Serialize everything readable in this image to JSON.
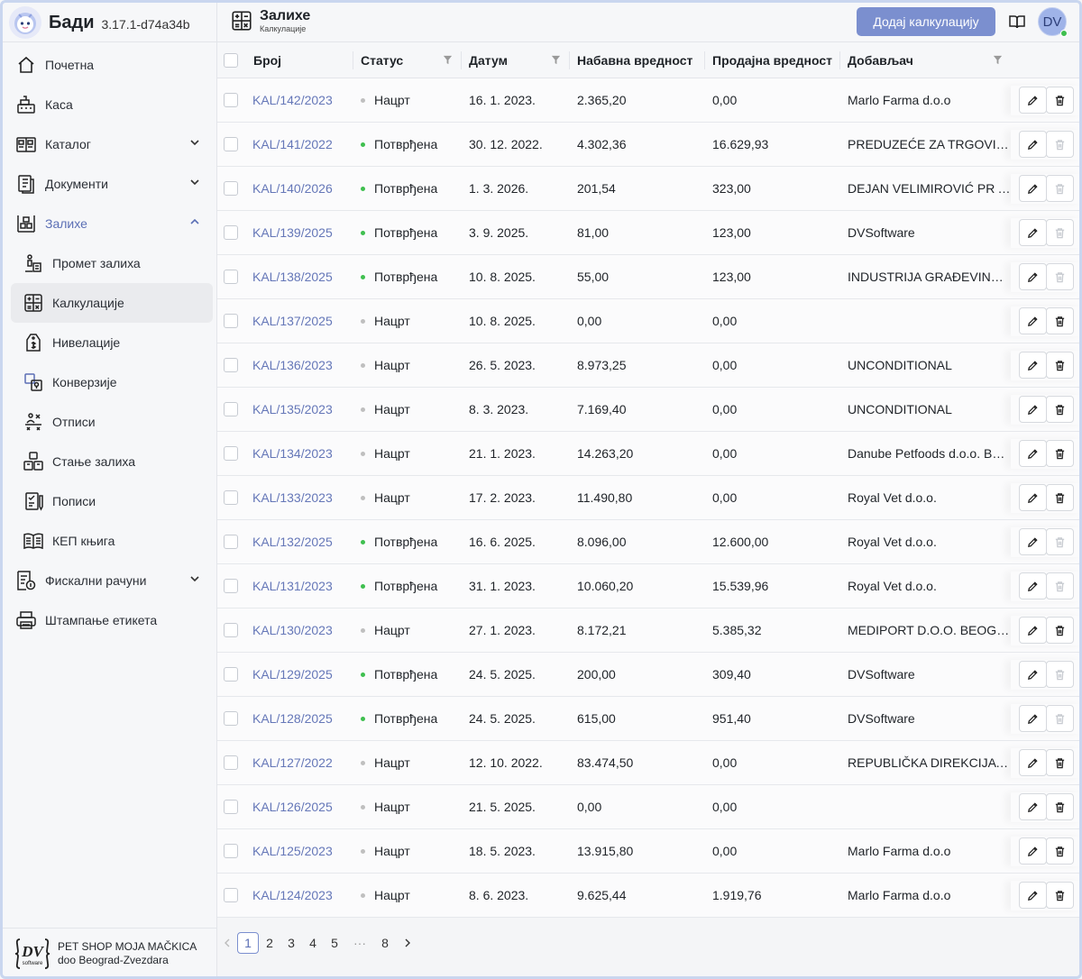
{
  "app": {
    "name": "Бади",
    "version": "3.17.1-d74a34b"
  },
  "sidebar": {
    "items": [
      {
        "label": "Почетна",
        "icon": "home-icon"
      },
      {
        "label": "Каса",
        "icon": "cash-register-icon"
      },
      {
        "label": "Каталог",
        "icon": "catalog-icon"
      },
      {
        "label": "Документи",
        "icon": "documents-icon"
      },
      {
        "label": "Залихе",
        "icon": "inventory-icon"
      },
      {
        "label": "Промет залиха",
        "icon": "stock-movement-icon"
      },
      {
        "label": "Калкулације",
        "icon": "calculator-icon"
      },
      {
        "label": "Нивелације",
        "icon": "price-tag-icon"
      },
      {
        "label": "Конверзије",
        "icon": "conversion-icon"
      },
      {
        "label": "Отписи",
        "icon": "write-off-icon"
      },
      {
        "label": "Стање залиха",
        "icon": "boxes-icon"
      },
      {
        "label": "Пописи",
        "icon": "clipboard-check-icon"
      },
      {
        "label": "КЕП књига",
        "icon": "book-icon"
      },
      {
        "label": "Фискални рачуни",
        "icon": "fiscal-receipt-icon"
      },
      {
        "label": "Штампање етикета",
        "icon": "printer-icon"
      }
    ]
  },
  "company": {
    "line1": "PET SHOP MOJA MAČKICA",
    "line2": "doo Beograd-Zvezdara",
    "logo_text": "DV",
    "logo_sub": "software"
  },
  "header": {
    "title": "Залихе",
    "subtitle": "Калкулације",
    "add_button": "Додај калкулацију",
    "avatar": "DV"
  },
  "table": {
    "columns": [
      "Број",
      "Статус",
      "Датум",
      "Набавна вредност",
      "Продајна вредност",
      "Добављач"
    ],
    "rows": [
      {
        "number": "KAL/142/2023",
        "status": "Нацрт",
        "date": "16. 1. 2023.",
        "purchase": "2.365,20",
        "sale": "0,00",
        "supplier": "Marlo Farma d.o.o"
      },
      {
        "number": "KAL/141/2022",
        "status": "Потврђена",
        "date": "30. 12. 2022.",
        "purchase": "4.302,36",
        "sale": "16.629,93",
        "supplier": "PREDUZEĆE ZA TRGOVINU"
      },
      {
        "number": "KAL/140/2026",
        "status": "Потврђена",
        "date": "1. 3. 2026.",
        "purchase": "201,54",
        "sale": "323,00",
        "supplier": "DEJAN VELIMIROVIĆ PR AGENCIJA"
      },
      {
        "number": "KAL/139/2025",
        "status": "Потврђена",
        "date": "3. 9. 2025.",
        "purchase": "81,00",
        "sale": "123,00",
        "supplier": "DVSoftware"
      },
      {
        "number": "KAL/138/2025",
        "status": "Потврђена",
        "date": "10. 8. 2025.",
        "purchase": "55,00",
        "sale": "123,00",
        "supplier": "INDUSTRIJA GRAĐEVINSKOG"
      },
      {
        "number": "KAL/137/2025",
        "status": "Нацрт",
        "date": "10. 8. 2025.",
        "purchase": "0,00",
        "sale": "0,00",
        "supplier": ""
      },
      {
        "number": "KAL/136/2023",
        "status": "Нацрт",
        "date": "26. 5. 2023.",
        "purchase": "8.973,25",
        "sale": "0,00",
        "supplier": "UNCONDITIONAL"
      },
      {
        "number": "KAL/135/2023",
        "status": "Нацрт",
        "date": "8. 3. 2023.",
        "purchase": "7.169,40",
        "sale": "0,00",
        "supplier": "UNCONDITIONAL"
      },
      {
        "number": "KAL/134/2023",
        "status": "Нацрт",
        "date": "21. 1. 2023.",
        "purchase": "14.263,20",
        "sale": "0,00",
        "supplier": "Danube Petfoods d.o.o. Beograd"
      },
      {
        "number": "KAL/133/2023",
        "status": "Нацрт",
        "date": "17. 2. 2023.",
        "purchase": "11.490,80",
        "sale": "0,00",
        "supplier": "Royal Vet d.o.o."
      },
      {
        "number": "KAL/132/2025",
        "status": "Потврђена",
        "date": "16. 6. 2025.",
        "purchase": "8.096,00",
        "sale": "12.600,00",
        "supplier": "Royal Vet d.o.o."
      },
      {
        "number": "KAL/131/2023",
        "status": "Потврђена",
        "date": "31. 1. 2023.",
        "purchase": "10.060,20",
        "sale": "15.539,96",
        "supplier": "Royal Vet d.o.o."
      },
      {
        "number": "KAL/130/2023",
        "status": "Нацрт",
        "date": "27. 1. 2023.",
        "purchase": "8.172,21",
        "sale": "5.385,32",
        "supplier": "MEDIPORT D.O.O. BEOGRAD"
      },
      {
        "number": "KAL/129/2025",
        "status": "Потврђена",
        "date": "24. 5. 2025.",
        "purchase": "200,00",
        "sale": "309,40",
        "supplier": "DVSoftware"
      },
      {
        "number": "KAL/128/2025",
        "status": "Потврђена",
        "date": "24. 5. 2025.",
        "purchase": "615,00",
        "sale": "951,40",
        "supplier": "DVSoftware"
      },
      {
        "number": "KAL/127/2022",
        "status": "Нацрт",
        "date": "12. 10. 2022.",
        "purchase": "83.474,50",
        "sale": "0,00",
        "supplier": "REPUBLIČKA DIREKCIJA ZA"
      },
      {
        "number": "KAL/126/2025",
        "status": "Нацрт",
        "date": "21. 5. 2025.",
        "purchase": "0,00",
        "sale": "0,00",
        "supplier": ""
      },
      {
        "number": "KAL/125/2023",
        "status": "Нацрт",
        "date": "18. 5. 2023.",
        "purchase": "13.915,80",
        "sale": "0,00",
        "supplier": "Marlo Farma d.o.o"
      },
      {
        "number": "KAL/124/2023",
        "status": "Нацрт",
        "date": "8. 6. 2023.",
        "purchase": "9.625,44",
        "sale": "1.919,76",
        "supplier": "Marlo Farma d.o.o"
      }
    ]
  },
  "pagination": {
    "pages": [
      "1",
      "2",
      "3",
      "4",
      "5",
      "···",
      "8"
    ],
    "current": "1"
  },
  "colors": {
    "accent": "#7b8fcf",
    "link": "#6577b8",
    "confirmed": "#3fbf4f",
    "draft": "#bfbfbf"
  }
}
